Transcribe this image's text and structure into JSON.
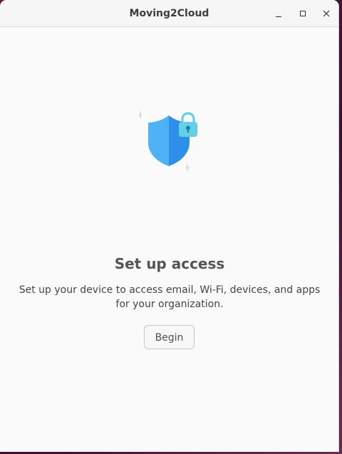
{
  "window": {
    "title": "Moving2Cloud",
    "controls": [
      "minimize",
      "maximize",
      "close"
    ]
  },
  "main": {
    "illustration_icon": "shield-with-lock-icon",
    "heading": "Set up access",
    "description": "Set up your device to access email, Wi-Fi, devices, and apps for your organization.",
    "begin_label": "Begin"
  },
  "colors": {
    "shield_light": "#4fb2f7",
    "shield_dark": "#2d8fe8",
    "lock": "#63d0e6"
  }
}
